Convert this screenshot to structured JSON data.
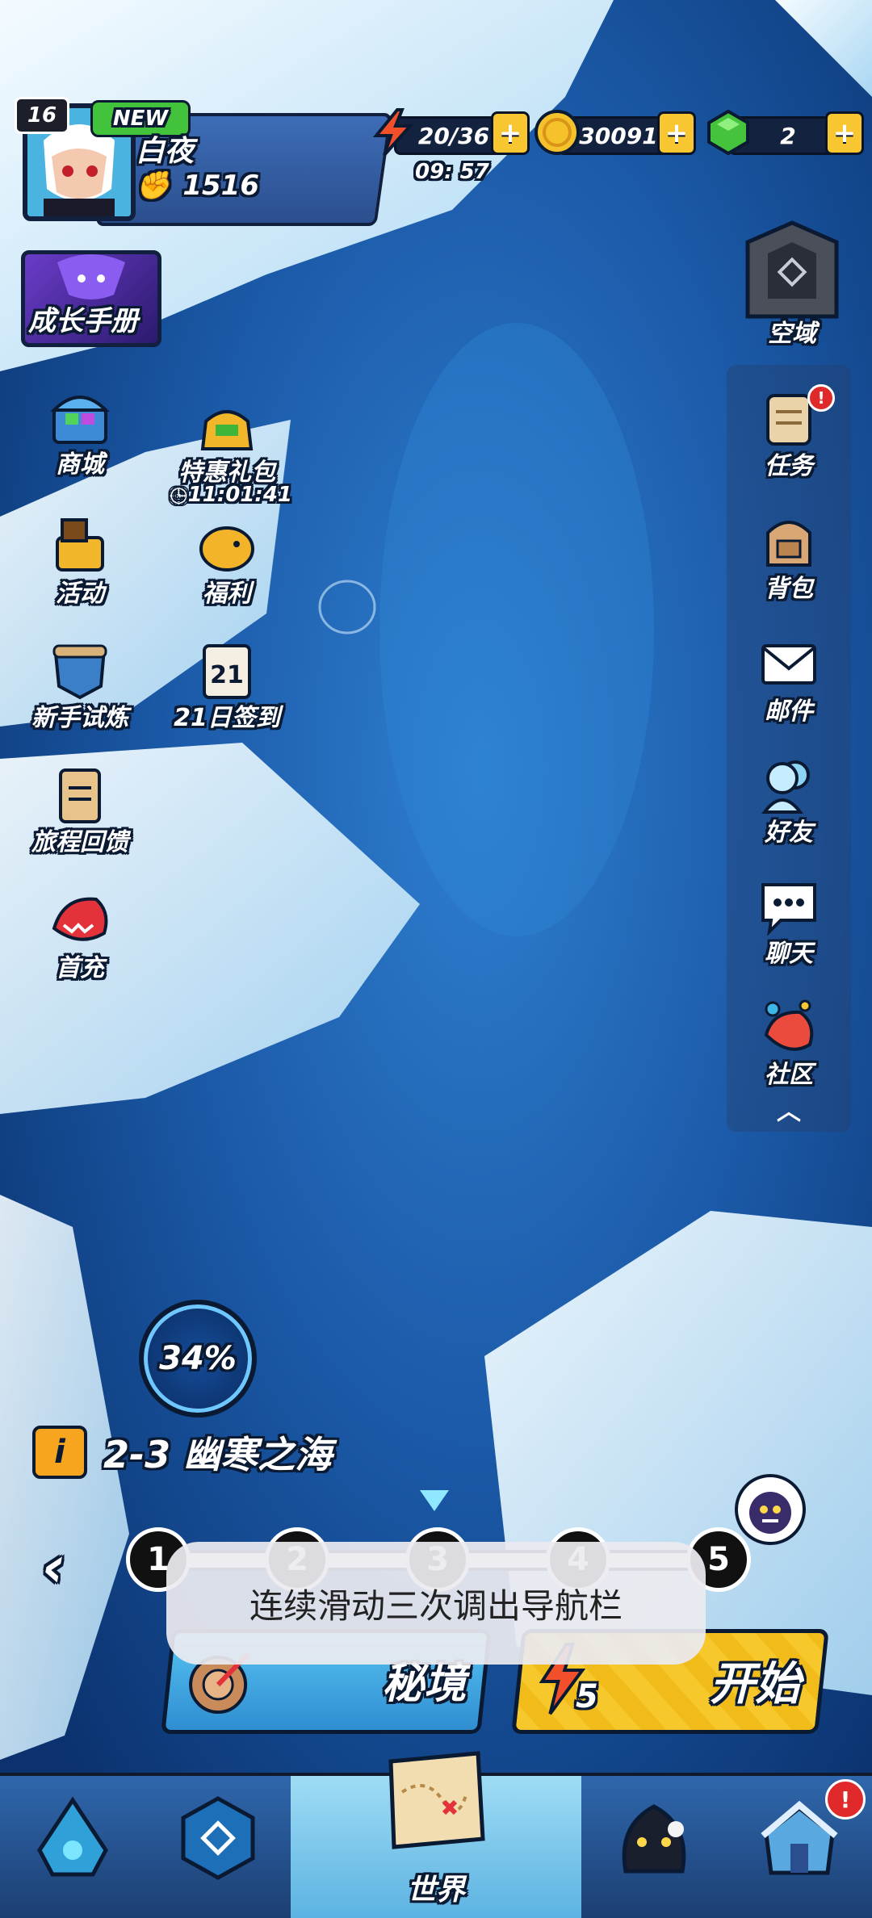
{
  "player": {
    "level": "16",
    "new_tag": "NEW",
    "name": "白夜",
    "power": "1516"
  },
  "resources": {
    "energy": "20/36",
    "energy_timer": "09: 57",
    "gold": "30091",
    "gems": "2",
    "plus": "+"
  },
  "left_menu": {
    "growth_manual": "成长手册",
    "shop": "商城",
    "special_pack": "特惠礼包",
    "special_pack_timer": "11:01:41",
    "events": "活动",
    "welfare": "福利",
    "novice_trial": "新手试炼",
    "signin_21": "21日签到",
    "journey_feedback": "旅程回馈",
    "first_charge": "首充"
  },
  "right_menu": {
    "airspace": "空域",
    "quests": "任务",
    "bag": "背包",
    "mail": "邮件",
    "friends": "好友",
    "chat": "聊天",
    "community": "社区",
    "collapse": "︿"
  },
  "stage": {
    "progress": "34%",
    "info_icon": "i",
    "name": "2-3 幽寒之海",
    "nodes": [
      "1",
      "2",
      "3",
      "4",
      "5"
    ],
    "back_chevron": "‹"
  },
  "actions": {
    "secret_realm": "秘境",
    "start": "开始",
    "start_cost": "5"
  },
  "toast": "连续滑动三次调出导航栏",
  "bottom_nav": {
    "world": "世界",
    "badge": "!"
  },
  "colors": {
    "accent_yellow": "#f6c82b",
    "panel_blue": "#2b4f8e",
    "outline": "#0b1a33"
  }
}
